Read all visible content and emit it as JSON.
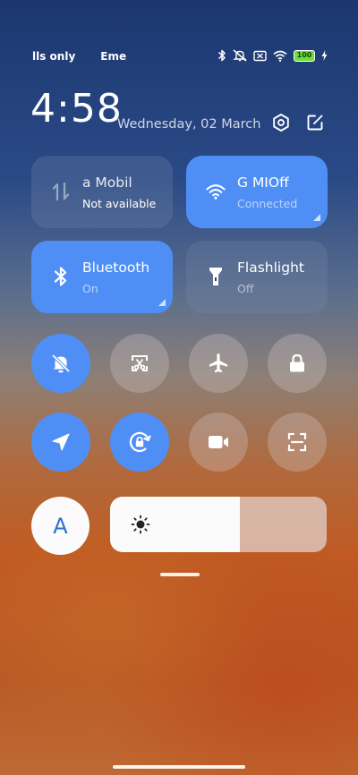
{
  "status_bar": {
    "left_text_1": "lls only",
    "left_text_2": "Eme",
    "battery": "100",
    "icons": [
      "bluetooth-icon",
      "vibrate-off-icon",
      "no-sim-icon",
      "wifi-icon",
      "battery-icon",
      "charging-bolt-icon"
    ]
  },
  "header": {
    "time": "4:58",
    "date": "Wednesday, 02 March",
    "icons": [
      "settings-icon",
      "edit-icon"
    ]
  },
  "tiles": {
    "mobile": {
      "title": "a      Mobil",
      "subtitle": "Not available",
      "state": "off",
      "icon": "mobile-data-icon"
    },
    "wifi": {
      "title": "G       MIOff",
      "subtitle": "Connected",
      "state": "on",
      "icon": "wifi-icon"
    },
    "bluetooth": {
      "title": "Bluetooth",
      "subtitle": "On",
      "state": "on",
      "icon": "bluetooth-icon"
    },
    "flashlight": {
      "title": "Flashlight",
      "subtitle": "Off",
      "state": "off",
      "icon": "flashlight-icon"
    }
  },
  "toggles": [
    {
      "name": "silent-toggle",
      "icon": "bell-off-icon",
      "state": "on"
    },
    {
      "name": "screenshot-toggle",
      "icon": "screenshot-icon",
      "state": "off"
    },
    {
      "name": "airplane-toggle",
      "icon": "airplane-icon",
      "state": "off"
    },
    {
      "name": "lock-screen-toggle",
      "icon": "lock-icon",
      "state": "off"
    },
    {
      "name": "location-toggle",
      "icon": "location-arrow-icon",
      "state": "on"
    },
    {
      "name": "auto-rotate-toggle",
      "icon": "rotate-lock-icon",
      "state": "on"
    },
    {
      "name": "screen-recorder-toggle",
      "icon": "video-camera-icon",
      "state": "off"
    },
    {
      "name": "scanner-toggle",
      "icon": "scan-icon",
      "state": "off"
    }
  ],
  "brightness": {
    "auto_label": "A",
    "level": 0.6,
    "icon": "sun-icon"
  },
  "colors": {
    "accent": "#4f8ff5",
    "battery": "#6be03a"
  }
}
